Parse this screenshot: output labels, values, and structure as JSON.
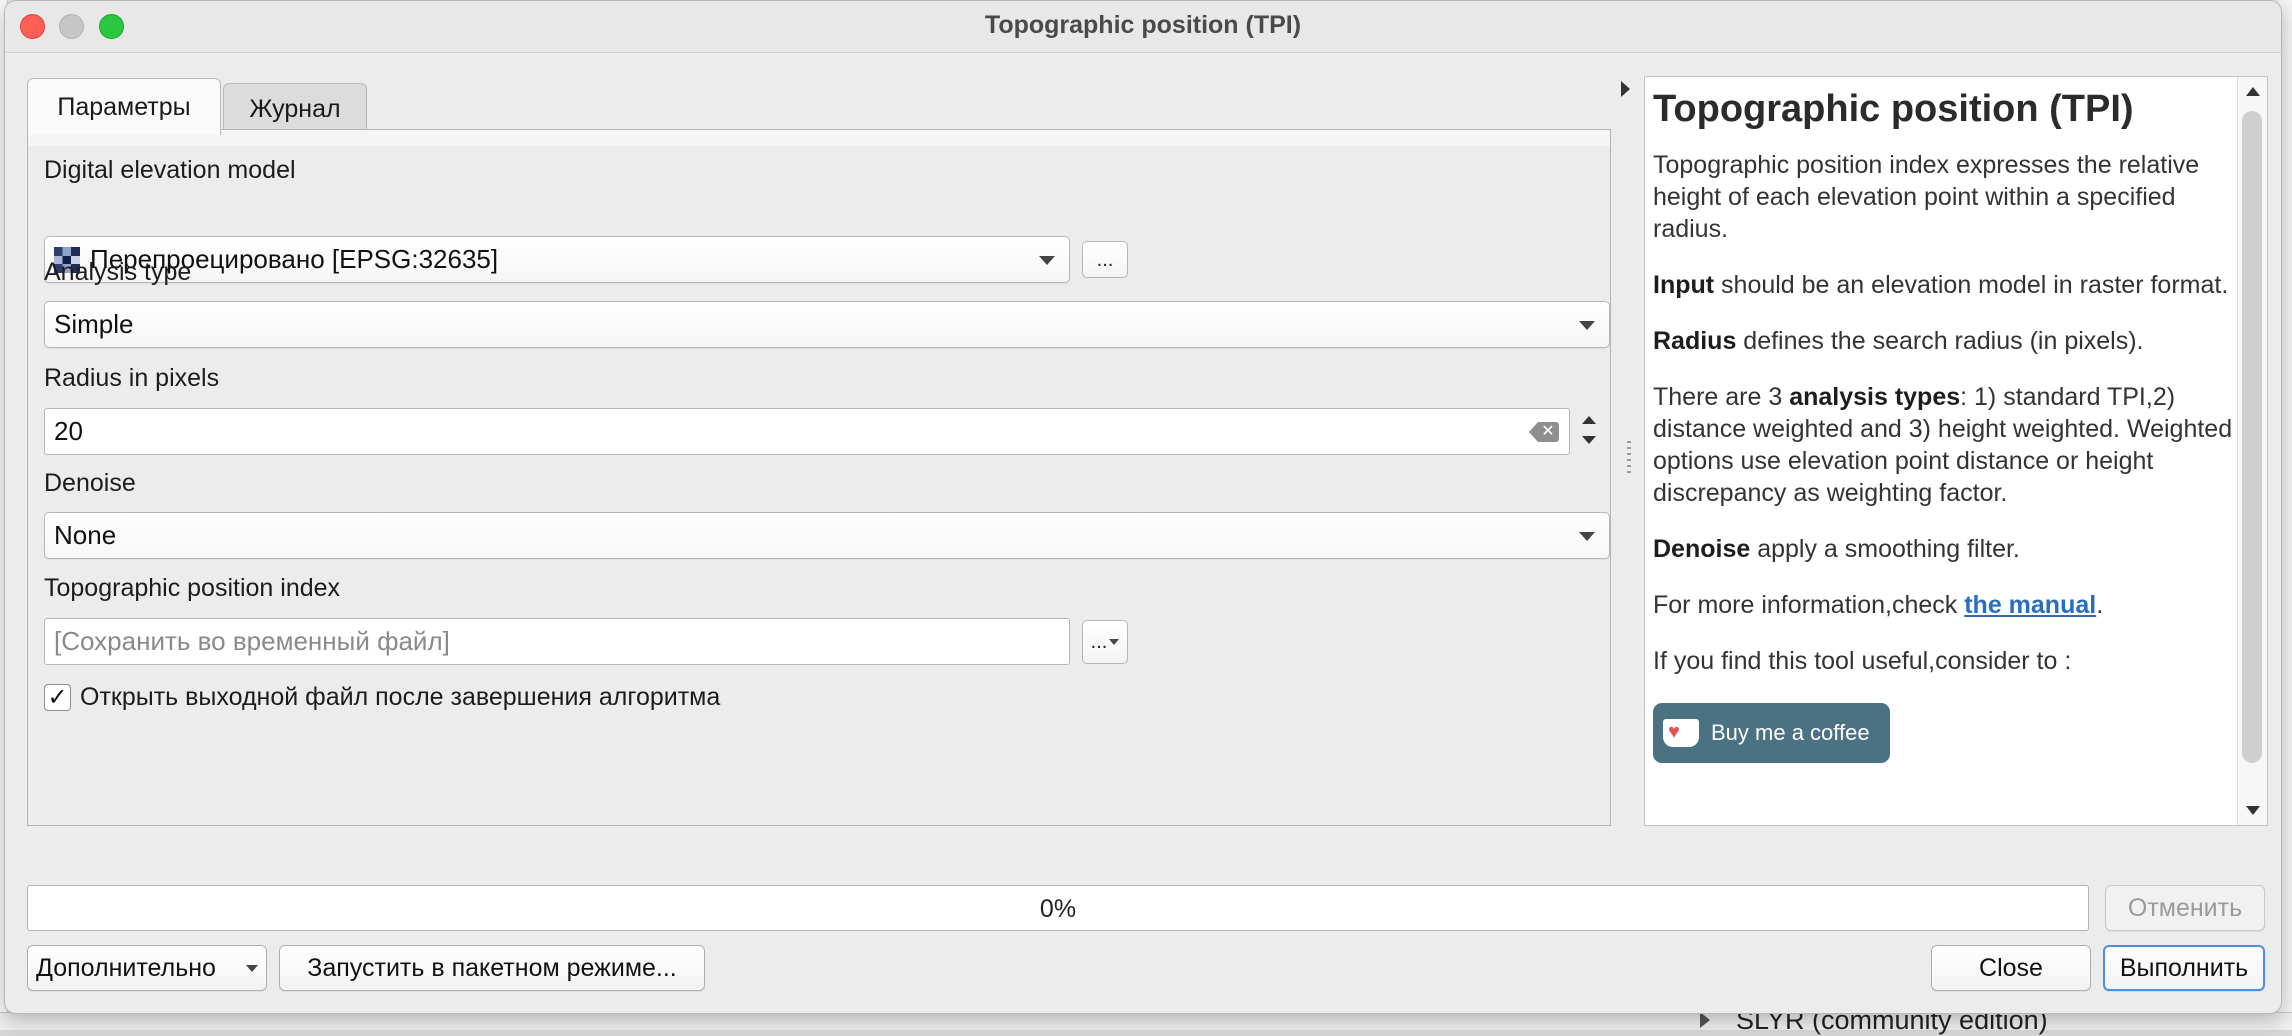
{
  "window": {
    "title": "Topographic position (TPI)"
  },
  "tabs": [
    {
      "label": "Параметры",
      "active": true
    },
    {
      "label": "Журнал",
      "active": false
    }
  ],
  "params": {
    "dem": {
      "label": "Digital elevation model",
      "value": "Перепроецировано [EPSG:32635]",
      "browse_label": "..."
    },
    "analysis_type": {
      "label": "Analysis type",
      "value": "Simple"
    },
    "radius": {
      "label": "Radius in pixels",
      "value": "20"
    },
    "denoise": {
      "label": "Denoise",
      "value": "None"
    },
    "output": {
      "label": "Topographic position index",
      "placeholder": "[Сохранить во временный файл]",
      "browse_label": "..."
    },
    "open_output": {
      "label": "Открыть выходной файл после завершения алгоритма",
      "checked": true,
      "mark": "✓"
    }
  },
  "help": {
    "title": "Topographic position (TPI)",
    "p1": "Topographic position index expresses the relative height of each elevation point within a specified radius.",
    "p2_bold": "Input",
    "p2_rest": " should be an elevation model in raster format.",
    "p3_bold": "Radius",
    "p3_rest": " defines the search radius (in pixels).",
    "p4_start": "There are 3 ",
    "p4_bold": "analysis types",
    "p4_rest": ": 1) standard TPI,2) distance weighted and 3) height weighted. Weighted options use elevation point distance or height discrepancy as weighting factor.",
    "p5_bold": "Denoise",
    "p5_rest": " apply a smoothing filter.",
    "p6_start": "For more information,check ",
    "p6_link": "the manual",
    "p6_end": ".",
    "p7": "If you find this tool useful,consider to :",
    "coffee_label": "Buy me a coffee"
  },
  "progress": {
    "value": 0,
    "label": "0%"
  },
  "buttons": {
    "cancel": "Отменить",
    "advanced": "Дополнительно",
    "batch": "Запустить в пакетном режиме...",
    "close": "Close",
    "run": "Выполнить"
  },
  "background": {
    "bottom_text": "SLYR (community edition)"
  },
  "colors": {
    "accent": "#4a8fe7",
    "coffee": "#4a7283",
    "link": "#2a6ebb"
  }
}
